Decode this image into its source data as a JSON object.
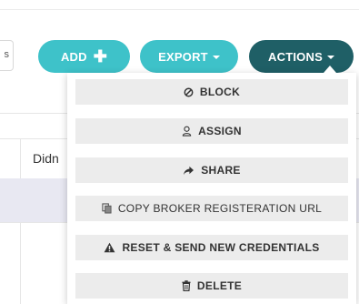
{
  "search": {
    "partial_text": "s"
  },
  "toolbar": {
    "add_label": "ADD",
    "add_icon": "plus-icon",
    "export_label": "EXPORT",
    "actions_label": "ACTIONS",
    "add_color": "#3ec2c9",
    "export_color": "#3ec2c9",
    "actions_color": "#1f5f66"
  },
  "table": {
    "header_partial": "Didn"
  },
  "actions_menu": {
    "items": [
      {
        "label": "BLOCK",
        "icon": "block-icon"
      },
      {
        "label": "ASSIGN",
        "icon": "user-icon"
      },
      {
        "label": "SHARE",
        "icon": "share-icon"
      },
      {
        "label": "COPY BROKER REGISTERATION URL",
        "icon": "copy-icon"
      },
      {
        "label": "RESET & SEND NEW CREDENTIALS",
        "icon": "warning-icon"
      },
      {
        "label": "DELETE",
        "icon": "trash-icon"
      }
    ]
  }
}
